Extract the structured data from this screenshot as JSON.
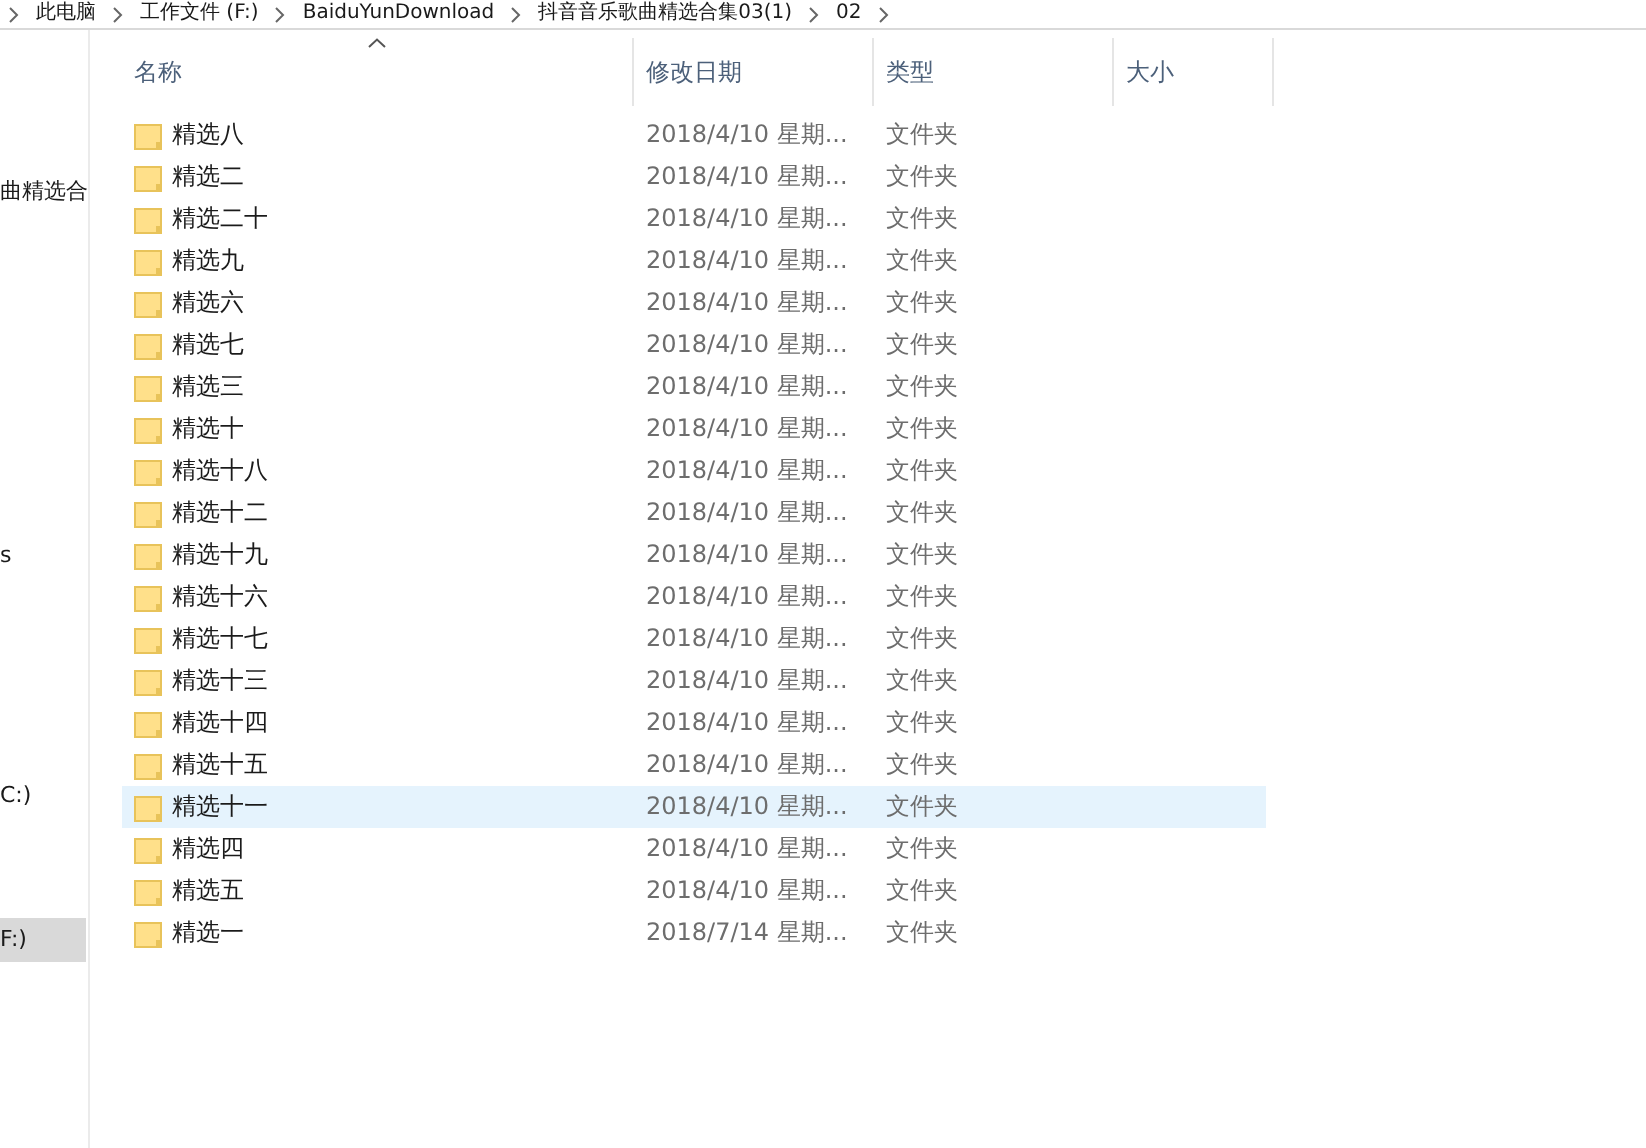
{
  "breadcrumb": [
    "此电脑",
    "工作文件 (F:)",
    "BaiduYunDownload",
    "抖音音乐歌曲精选合集03(1)",
    "02"
  ],
  "sidebar": {
    "items": [
      {
        "label": "曲精选合",
        "selected": false
      },
      {
        "label": "s",
        "selected": false
      },
      {
        "label": "C:)",
        "selected": false
      },
      {
        "label": "F:)",
        "selected": true
      }
    ]
  },
  "table": {
    "columns": [
      {
        "label": "名称",
        "sorted": true
      },
      {
        "label": "修改日期",
        "sorted": false
      },
      {
        "label": "类型",
        "sorted": false
      },
      {
        "label": "大小",
        "sorted": false
      }
    ],
    "rows": [
      {
        "name": "精选八",
        "date": "2018/4/10 星期...",
        "type": "文件夹",
        "selected": false
      },
      {
        "name": "精选二",
        "date": "2018/4/10 星期...",
        "type": "文件夹",
        "selected": false
      },
      {
        "name": "精选二十",
        "date": "2018/4/10 星期...",
        "type": "文件夹",
        "selected": false
      },
      {
        "name": "精选九",
        "date": "2018/4/10 星期...",
        "type": "文件夹",
        "selected": false
      },
      {
        "name": "精选六",
        "date": "2018/4/10 星期...",
        "type": "文件夹",
        "selected": false
      },
      {
        "name": "精选七",
        "date": "2018/4/10 星期...",
        "type": "文件夹",
        "selected": false
      },
      {
        "name": "精选三",
        "date": "2018/4/10 星期...",
        "type": "文件夹",
        "selected": false
      },
      {
        "name": "精选十",
        "date": "2018/4/10 星期...",
        "type": "文件夹",
        "selected": false
      },
      {
        "name": "精选十八",
        "date": "2018/4/10 星期...",
        "type": "文件夹",
        "selected": false
      },
      {
        "name": "精选十二",
        "date": "2018/4/10 星期...",
        "type": "文件夹",
        "selected": false
      },
      {
        "name": "精选十九",
        "date": "2018/4/10 星期...",
        "type": "文件夹",
        "selected": false
      },
      {
        "name": "精选十六",
        "date": "2018/4/10 星期...",
        "type": "文件夹",
        "selected": false
      },
      {
        "name": "精选十七",
        "date": "2018/4/10 星期...",
        "type": "文件夹",
        "selected": false
      },
      {
        "name": "精选十三",
        "date": "2018/4/10 星期...",
        "type": "文件夹",
        "selected": false
      },
      {
        "name": "精选十四",
        "date": "2018/4/10 星期...",
        "type": "文件夹",
        "selected": false
      },
      {
        "name": "精选十五",
        "date": "2018/4/10 星期...",
        "type": "文件夹",
        "selected": false
      },
      {
        "name": "精选十一",
        "date": "2018/4/10 星期...",
        "type": "文件夹",
        "selected": true
      },
      {
        "name": "精选四",
        "date": "2018/4/10 星期...",
        "type": "文件夹",
        "selected": false
      },
      {
        "name": "精选五",
        "date": "2018/4/10 星期...",
        "type": "文件夹",
        "selected": false
      },
      {
        "name": "精选一",
        "date": "2018/7/14 星期...",
        "type": "文件夹",
        "selected": false
      }
    ]
  }
}
